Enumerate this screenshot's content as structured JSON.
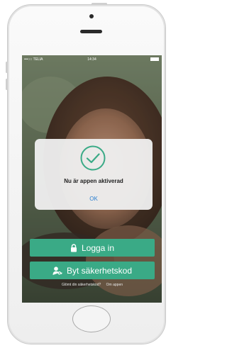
{
  "status_bar": {
    "carrier": "•••○○ TELIA",
    "time": "14:34"
  },
  "dialog": {
    "message": "Nu är appen aktiverad",
    "ok_label": "OK"
  },
  "buttons": {
    "login_label": "Logga in",
    "change_code_label": "Byt säkerhetskod"
  },
  "links": {
    "forgot_code": "Glömt din säkerhetskod?",
    "about_app": "Om appen"
  },
  "colors": {
    "accent_green": "#3aaa86",
    "ok_blue": "#2a7fd0"
  },
  "icons": [
    "lock-icon",
    "person-key-icon",
    "checkmark-circle-icon"
  ]
}
